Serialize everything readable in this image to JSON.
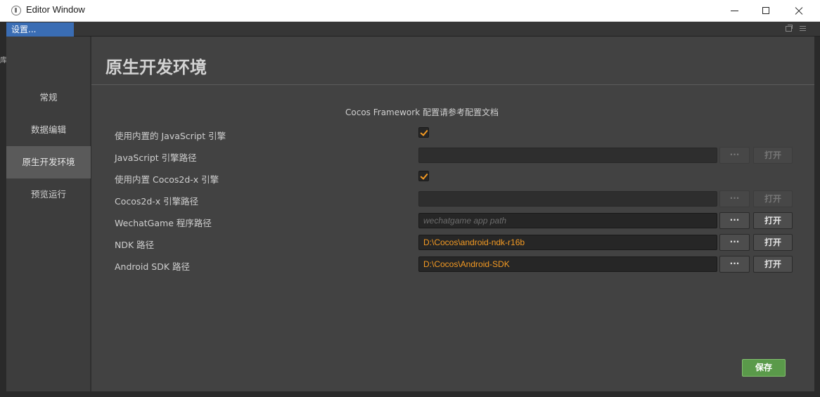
{
  "window": {
    "title": "Editor Window"
  },
  "tab": {
    "label": "设置..."
  },
  "edge": {
    "glyph": "库"
  },
  "sidebar": {
    "items": [
      {
        "label": "常规",
        "active": false
      },
      {
        "label": "数据编辑",
        "active": false
      },
      {
        "label": "原生开发环境",
        "active": true
      },
      {
        "label": "预览运行",
        "active": false
      }
    ]
  },
  "page": {
    "title": "原生开发环境",
    "info": "Cocos Framework 配置请参考配置文档"
  },
  "settings": {
    "use_builtin_js": {
      "label": "使用内置的 JavaScript 引擎",
      "checked": true
    },
    "js_path": {
      "label": "JavaScript 引擎路径",
      "value": "",
      "enabled": false
    },
    "use_builtin_cocos2dx": {
      "label": "使用内置 Cocos2d-x 引擎",
      "checked": true
    },
    "cocos2dx_path": {
      "label": "Cocos2d-x 引擎路径",
      "value": "",
      "enabled": false
    },
    "wechatgame_path": {
      "label": "WechatGame 程序路径",
      "value": "",
      "placeholder": "wechatgame app path",
      "enabled": true
    },
    "ndk_path": {
      "label": "NDK 路径",
      "value": "D:\\Cocos\\android-ndk-r16b",
      "enabled": true
    },
    "android_sdk_path": {
      "label": "Android SDK 路径",
      "value": "D:\\Cocos\\Android-SDK",
      "enabled": true
    }
  },
  "buttons": {
    "browse": "···",
    "open": "打开",
    "save": "保存"
  },
  "colors": {
    "accent_path": "#f59b23",
    "tab_active": "#3a6db4",
    "save_button": "#5a9a4a"
  }
}
